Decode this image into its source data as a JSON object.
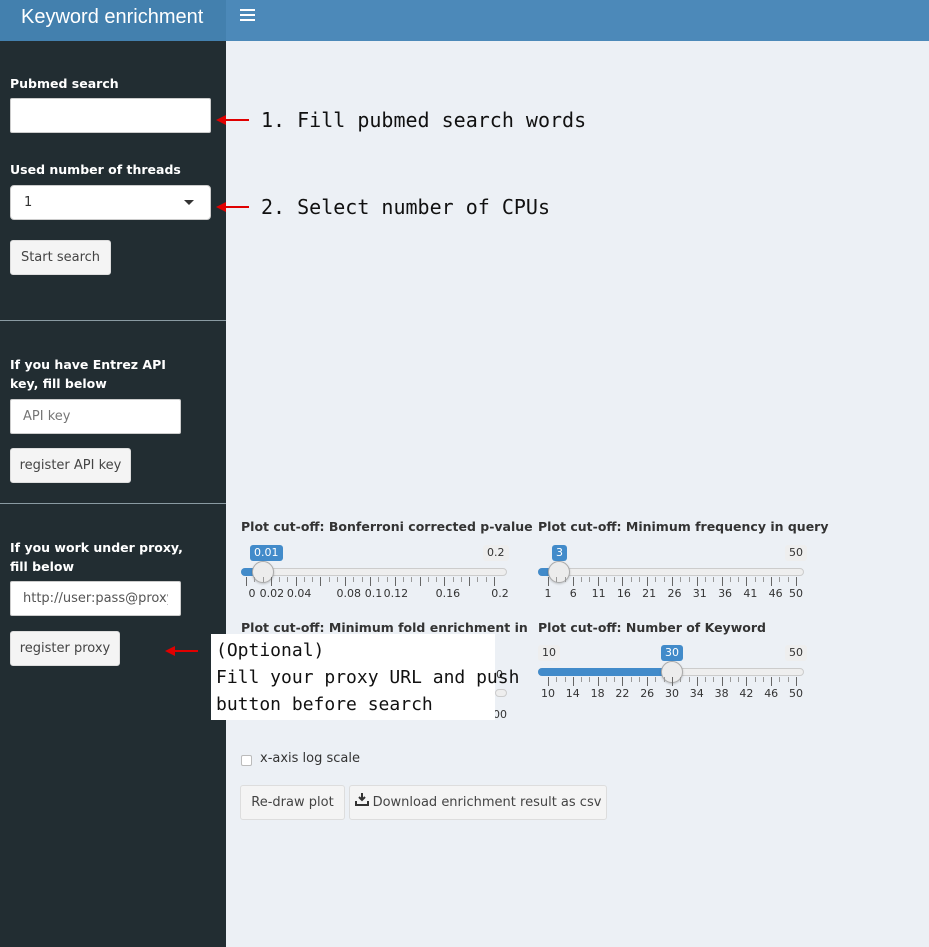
{
  "header": {
    "title": "Keyword enrichment"
  },
  "sidebar": {
    "pubmed": {
      "label": "Pubmed search",
      "value": "",
      "placeholder": ""
    },
    "threads": {
      "label": "Used number of threads",
      "selected": "1"
    },
    "start_button": "Start search",
    "api": {
      "label_line1": "If you have Entrez API",
      "label_line2": "key, fill below",
      "placeholder": "API key",
      "button": "register API key"
    },
    "proxy": {
      "label_line1": "If you work under proxy,",
      "label_line2": "fill below",
      "value": "http://user:pass@proxy",
      "button": "register proxy"
    }
  },
  "annotations": {
    "step1": "1. Fill pubmed search words",
    "step2": "2. Select number of CPUs",
    "optional_line1": "(Optional)",
    "optional_line2": "Fill your proxy URL and push",
    "optional_line3": "button before search"
  },
  "sliders": {
    "pvalue": {
      "title": "Plot cut-off: Bonferroni corrected p-value",
      "value": "0.01",
      "max": "0.2",
      "ticks": [
        "0",
        "0.02",
        "0.04",
        "0.08",
        "0.1",
        "0.12",
        "0.16",
        "0.2"
      ]
    },
    "minfreq": {
      "title": "Plot cut-off: Minimum frequency in query",
      "value": "3",
      "max": "50",
      "ticks": [
        "1",
        "6",
        "11",
        "16",
        "21",
        "26",
        "31",
        "36",
        "41",
        "46",
        "50"
      ]
    },
    "foldenrich": {
      "title": "Plot cut-off: Minimum fold enrichment in",
      "badge_right": "00",
      "tick_right": "00"
    },
    "numkeyword": {
      "title": "Plot cut-off: Number of Keyword",
      "min": "10",
      "value": "30",
      "max": "50",
      "ticks": [
        "10",
        "14",
        "18",
        "22",
        "26",
        "30",
        "34",
        "38",
        "42",
        "46",
        "50"
      ]
    }
  },
  "controls": {
    "log_scale_label": "x-axis log scale",
    "log_scale_checked": false,
    "redraw_button": "Re-draw plot",
    "download_button": "Download enrichment result as csv"
  }
}
